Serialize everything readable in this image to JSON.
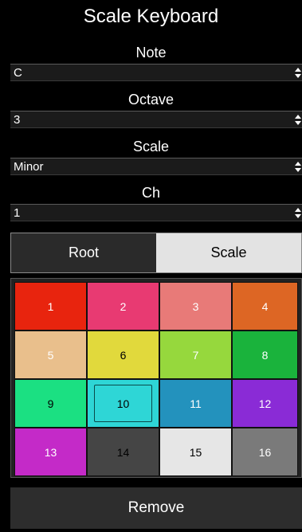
{
  "title": "Scale Keyboard",
  "fields": {
    "note": {
      "label": "Note",
      "value": "C"
    },
    "octave": {
      "label": "Octave",
      "value": "3"
    },
    "scale": {
      "label": "Scale",
      "value": "Minor"
    },
    "ch": {
      "label": "Ch",
      "value": "1"
    }
  },
  "segment": {
    "root": "Root",
    "scale": "Scale",
    "selected": "Scale"
  },
  "pads": [
    {
      "label": "1",
      "color": "#e8240e"
    },
    {
      "label": "2",
      "color": "#e83a72"
    },
    {
      "label": "3",
      "color": "#e87a78"
    },
    {
      "label": "4",
      "color": "#dd6624"
    },
    {
      "label": "5",
      "color": "#e9bf8c"
    },
    {
      "label": "6",
      "color": "#e1d93c"
    },
    {
      "label": "7",
      "color": "#96d83d"
    },
    {
      "label": "8",
      "color": "#1ab33c"
    },
    {
      "label": "9",
      "color": "#1be082"
    },
    {
      "label": "10",
      "color": "#2ed6d6"
    },
    {
      "label": "11",
      "color": "#2392bd"
    },
    {
      "label": "12",
      "color": "#8a2bd6"
    },
    {
      "label": "13",
      "color": "#c42ac8"
    },
    {
      "label": "14",
      "color": "#454545"
    },
    {
      "label": "15",
      "color": "#e6e6e6"
    },
    {
      "label": "16",
      "color": "#7a7a7a"
    }
  ],
  "selected_pad": "10",
  "remove_label": "Remove"
}
